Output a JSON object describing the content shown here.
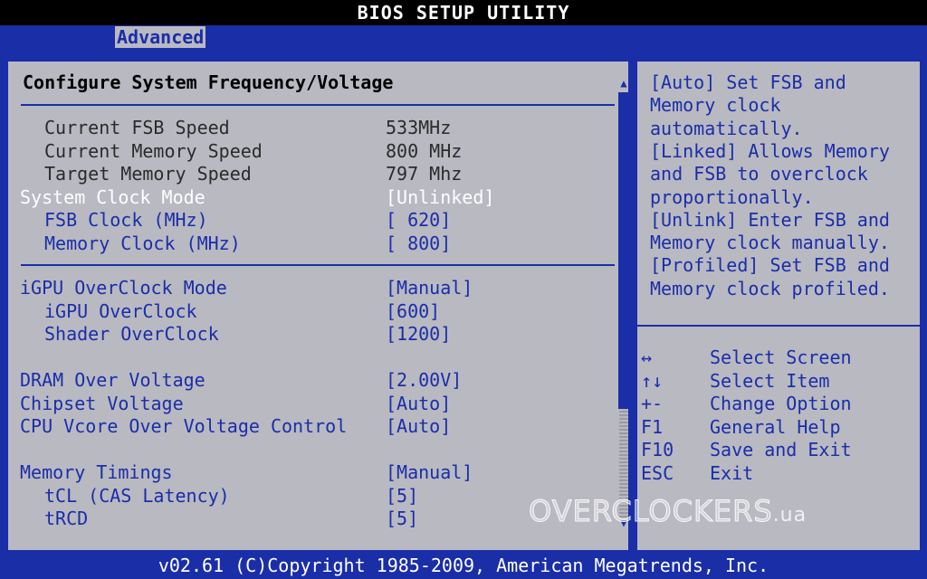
{
  "title": "BIOS SETUP UTILITY",
  "tabs": [
    {
      "label": "Advanced",
      "active": true
    }
  ],
  "section_title": "Configure System Frequency/Voltage",
  "groups": [
    [
      {
        "label": "Current FSB Speed",
        "value": "533MHz",
        "type": "info",
        "indent": 1
      },
      {
        "label": "Current Memory Speed",
        "value": "800 MHz",
        "type": "info",
        "indent": 1
      },
      {
        "label": "Target Memory Speed",
        "value": "797 Mhz",
        "type": "info",
        "indent": 1
      },
      {
        "label": "System Clock Mode",
        "value": "[Unlinked]",
        "type": "selected",
        "indent": 0
      },
      {
        "label": "FSB Clock (MHz)",
        "value": "[ 620]",
        "type": "item",
        "indent": 1
      },
      {
        "label": "Memory Clock (MHz)",
        "value": "[ 800]",
        "type": "item",
        "indent": 1
      }
    ],
    [
      {
        "label": "iGPU OverClock Mode",
        "value": "[Manual]",
        "type": "item",
        "indent": 0
      },
      {
        "label": "iGPU OverClock",
        "value": "[600]",
        "type": "item",
        "indent": 1
      },
      {
        "label": "Shader OverClock",
        "value": "[1200]",
        "type": "item",
        "indent": 1
      },
      {
        "label": "DRAM Over Voltage",
        "value": "[2.00V]",
        "type": "item",
        "indent": 0
      },
      {
        "label": "Chipset Voltage",
        "value": "[Auto]",
        "type": "item",
        "indent": 0
      },
      {
        "label": "CPU Vcore Over Voltage Control",
        "value": "[Auto]",
        "type": "item",
        "indent": 0
      },
      {
        "label": "Memory Timings",
        "value": "[Manual]",
        "type": "item",
        "indent": 0
      },
      {
        "label": "tCL (CAS Latency)",
        "value": "[5]",
        "type": "item",
        "indent": 1
      },
      {
        "label": "tRCD",
        "value": "[5]",
        "type": "item",
        "indent": 1
      }
    ]
  ],
  "help_text": [
    "[Auto] Set FSB and",
    "Memory clock",
    "automatically.",
    "[Linked] Allows Memory",
    "and FSB to overclock",
    "proportionally.",
    "[Unlink] Enter FSB and",
    "Memory clock manually.",
    "[Profiled] Set FSB and",
    "Memory clock profiled."
  ],
  "keys": [
    {
      "key": "↔",
      "desc": "Select Screen",
      "icon": "left-right-arrow-icon"
    },
    {
      "key": "↑↓",
      "desc": "Select Item",
      "icon": "up-down-arrow-icon"
    },
    {
      "key": "+-",
      "desc": "Change Option",
      "icon": "plus-minus-icon"
    },
    {
      "key": "F1",
      "desc": "General Help"
    },
    {
      "key": "F10",
      "desc": "Save and Exit"
    },
    {
      "key": "ESC",
      "desc": "Exit"
    }
  ],
  "footer": "v02.61 (C)Copyright 1985-2009, American Megatrends, Inc.",
  "watermark": {
    "main": "OVERCLOCKERS",
    "tld": ".ua"
  },
  "colors": {
    "bios_blue": "#1a2ea8",
    "panel_gray": "#b9b9c2",
    "selected_text": "#ffffff",
    "info_text": "#2b2b2b"
  }
}
